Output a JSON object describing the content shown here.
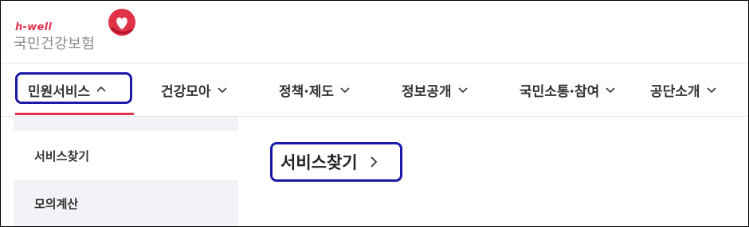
{
  "logo": {
    "small_text": "h-well",
    "main_text": "국민건강보험",
    "brand_color": "#e0334a"
  },
  "gnb": {
    "items": [
      {
        "label": "민원서비스",
        "icon": "chevron-up-icon",
        "active": true
      },
      {
        "label": "건강모아",
        "icon": "chevron-down-icon"
      },
      {
        "label": "정책·제도",
        "icon": "chevron-down-icon"
      },
      {
        "label": "정보공개",
        "icon": "chevron-down-icon"
      },
      {
        "label": "국민소통·참여",
        "icon": "chevron-down-icon"
      },
      {
        "label": "공단소개",
        "icon": "chevron-down-icon"
      }
    ]
  },
  "submenu": {
    "items": [
      {
        "label": "서비스찾기"
      },
      {
        "label": "모의계산"
      }
    ]
  },
  "content": {
    "link_label": "서비스찾기",
    "link_icon": "chevron-right-icon"
  },
  "colors": {
    "highlight_border": "#1a1aa6",
    "active_underline": "#e0334a",
    "submenu_bg": "#f2f3f7"
  }
}
